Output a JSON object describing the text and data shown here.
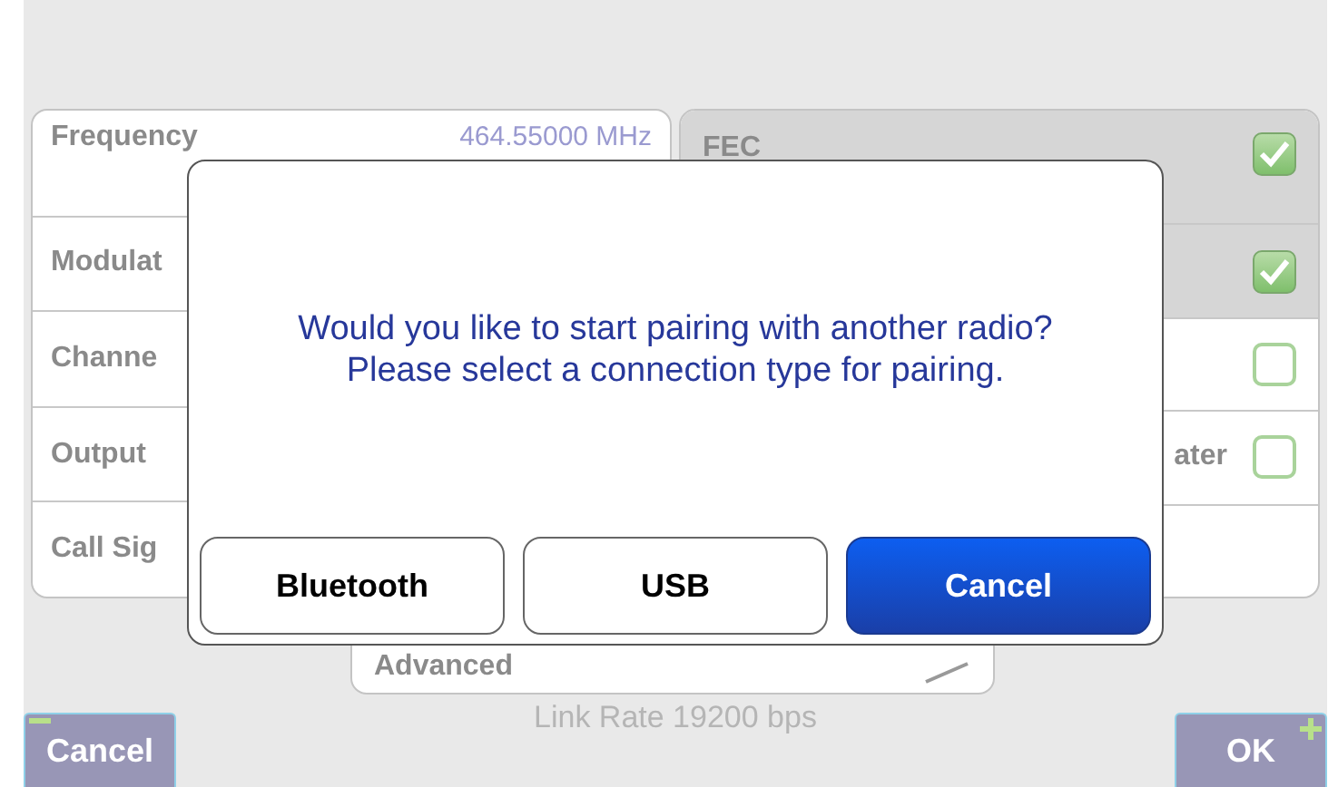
{
  "settings_left": [
    {
      "label": "Frequency",
      "value": "464.55000 MHz"
    },
    {
      "label": "Modulat"
    },
    {
      "label": "Channe"
    },
    {
      "label": "Output"
    },
    {
      "label": "Call Sig"
    }
  ],
  "settings_right": [
    {
      "kind": "checkbox",
      "label": "FEC",
      "selected": true,
      "checked": true
    },
    {
      "kind": "checkbox",
      "selected": true,
      "checked": true
    },
    {
      "kind": "checkbox",
      "selected": false,
      "checked": false
    },
    {
      "kind": "checkbox",
      "label": "ater",
      "selected": false,
      "checked": false
    },
    {
      "kind": "blank"
    }
  ],
  "advanced": {
    "label": "Advanced"
  },
  "link_rate": "Link Rate 19200 bps",
  "footer_buttons": [
    {
      "label": "Cancel",
      "kind": "minus"
    },
    {
      "label": "OK",
      "kind": "plus"
    }
  ],
  "dialog": {
    "message": [
      "Would you like to start pairing with another radio?",
      "Please select a connection type for pairing."
    ],
    "buttons": [
      {
        "label": "Bluetooth",
        "primary": false
      },
      {
        "label": "USB",
        "primary": false
      },
      {
        "label": "Cancel",
        "primary": true
      }
    ]
  }
}
